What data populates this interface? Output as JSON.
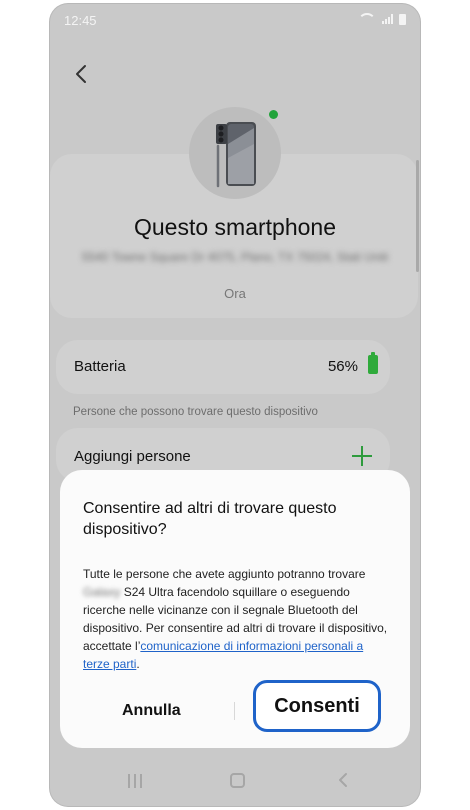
{
  "status_bar": {
    "time": "12:45"
  },
  "device": {
    "title": "Questo smartphone",
    "address": "5540 Towne Square Dr 4075, Plano, TX 75024, Stati Uniti",
    "updated": "Ora",
    "online_color": "#22a33b"
  },
  "battery": {
    "label": "Batteria",
    "value": "56%",
    "color": "#2faa3b"
  },
  "people_section": {
    "heading": "Persone che possono trovare questo dispositivo",
    "add_label": "Aggiungi persone"
  },
  "dialog": {
    "title": "Consentire ad altri di trovare questo dispositivo?",
    "body_before_name": "Tutte le persone che avete aggiunto potranno trovare ",
    "blurred_name": "Galaxy",
    "body_after_name": " S24 Ultra facendolo squillare o eseguendo ricerche nelle vicinanze con il segnale Bluetooth del dispositivo. Per consentire ad altri di trovare il dispositivo, accettate l’",
    "link_text": "comunicazione di informazioni personali a terze parti",
    "body_end": ".",
    "cancel_label": "Annulla",
    "confirm_label": "Consenti",
    "accent_color": "#1f63c9"
  },
  "icons": {
    "back": "chevron-left-icon",
    "add": "plus-icon",
    "nav_recents": "recents-icon",
    "nav_home": "home-icon",
    "nav_back": "back-icon"
  }
}
